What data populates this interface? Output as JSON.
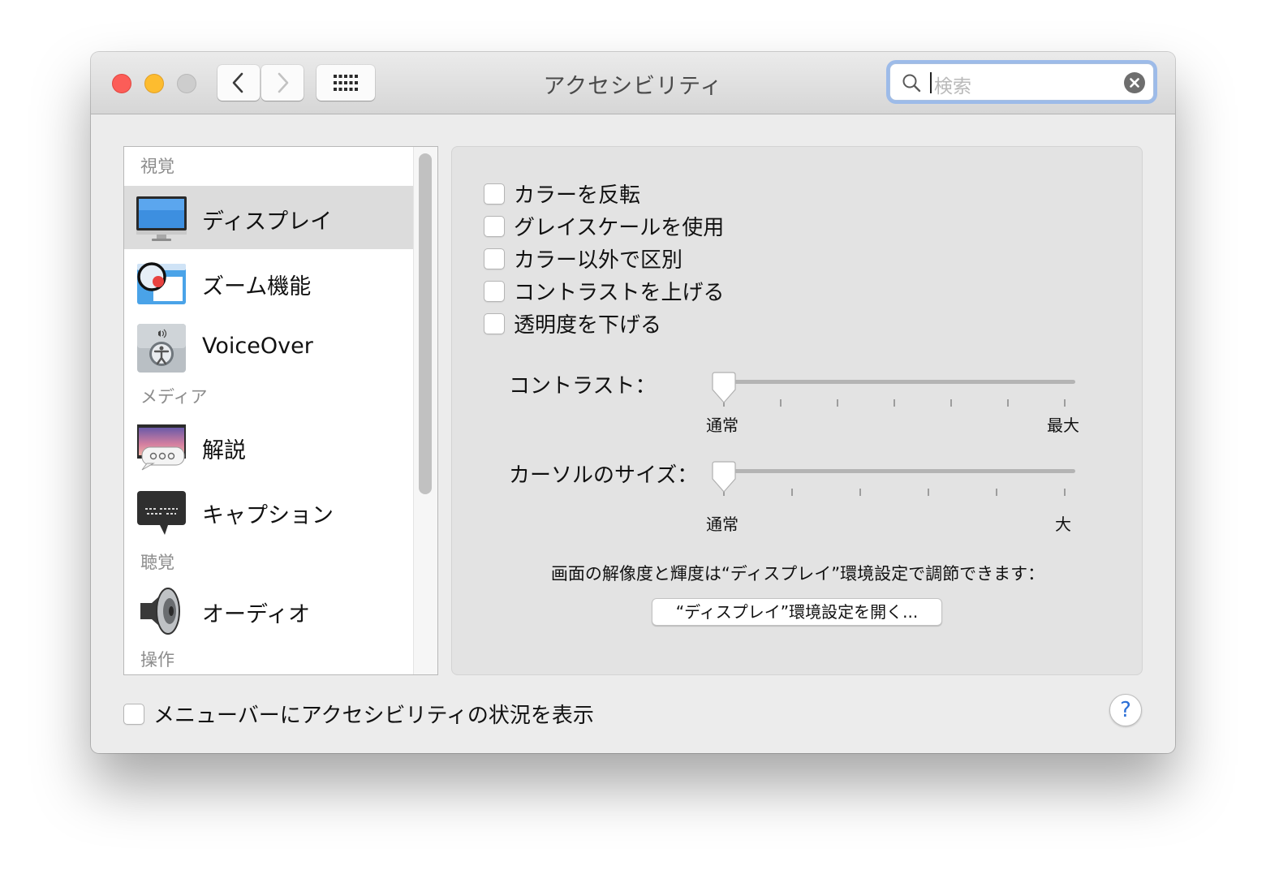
{
  "window": {
    "title": "アクセシビリティ"
  },
  "search": {
    "placeholder": "検索"
  },
  "sidebar": {
    "sections": [
      {
        "title": "視覚",
        "items": [
          {
            "label": "ディスプレイ",
            "icon": "display-icon",
            "selected": true
          },
          {
            "label": "ズーム機能",
            "icon": "zoom-icon"
          },
          {
            "label": "VoiceOver",
            "icon": "voiceover-icon"
          }
        ]
      },
      {
        "title": "メディア",
        "items": [
          {
            "label": "解説",
            "icon": "descriptions-icon"
          },
          {
            "label": "キャプション",
            "icon": "captions-icon"
          }
        ]
      },
      {
        "title": "聴覚",
        "items": [
          {
            "label": "オーディオ",
            "icon": "speaker-icon"
          }
        ]
      },
      {
        "title": "操作",
        "items": []
      }
    ]
  },
  "display": {
    "checkboxes": [
      {
        "label": "カラーを反転",
        "checked": false
      },
      {
        "label": "グレイスケールを使用",
        "checked": false
      },
      {
        "label": "カラー以外で区別",
        "checked": false
      },
      {
        "label": "コントラストを上げる",
        "checked": false
      },
      {
        "label": "透明度を下げる",
        "checked": false
      }
    ],
    "contrast": {
      "label": "コントラスト：",
      "min_label": "通常",
      "max_label": "最大",
      "value": 0
    },
    "cursor": {
      "label": "カーソルのサイズ：",
      "min_label": "通常",
      "max_label": "大",
      "value": 0
    },
    "note": "画面の解像度と輝度は“ディスプレイ”環境設定で調節できます：",
    "open_button": "“ディスプレイ”環境設定を開く..."
  },
  "footer": {
    "menubar_checkbox": {
      "label": "メニューバーにアクセシビリティの状況を表示",
      "checked": false
    },
    "help": "?"
  },
  "colors": {
    "accent": "#2b6fd6",
    "selection": "#dcdcdc",
    "focus_ring": "#9dbbe9"
  }
}
